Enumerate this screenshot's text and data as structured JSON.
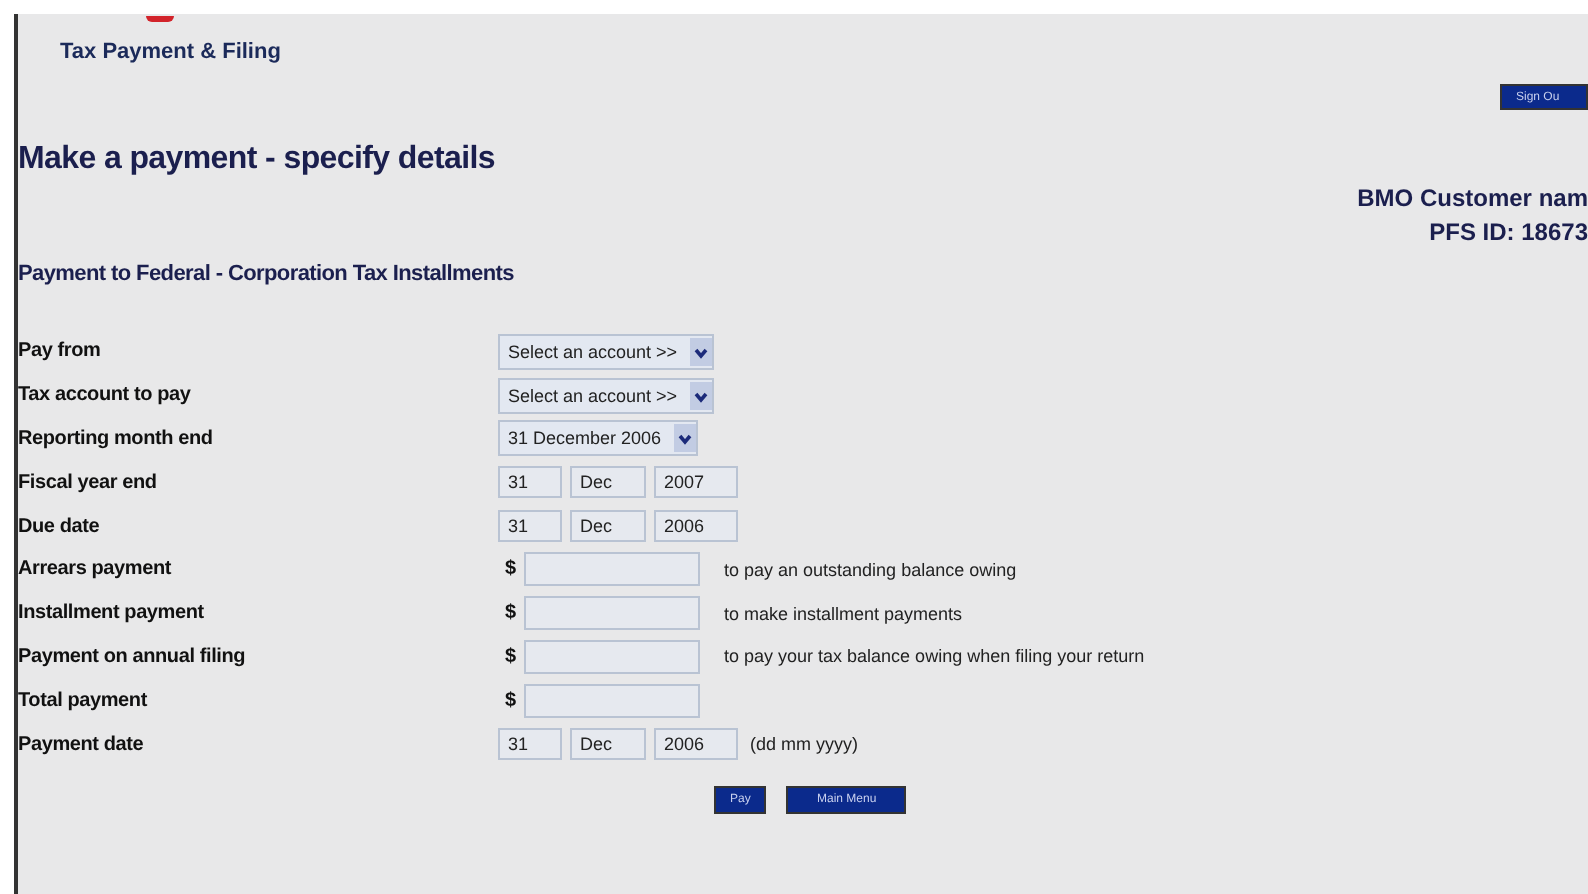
{
  "header": {
    "title": "Tax Payment & Filing",
    "sign_out": "Sign Ou"
  },
  "page_title": "Make a payment - specify details",
  "customer": {
    "name": "BMO Customer nam",
    "pfs_id": "PFS ID:  18673"
  },
  "section_title": "Payment to Federal - Corporation Tax Installments",
  "form_rows": [
    {
      "label": "Pay from",
      "kind": "select",
      "value": "Select an account >>"
    },
    {
      "label": "Tax account to pay",
      "kind": "select",
      "value": "Select an account >>"
    },
    {
      "label": "Reporting month end",
      "kind": "select",
      "value": "31 December 2006"
    },
    {
      "label": "Fiscal year end",
      "kind": "date",
      "day": "31",
      "month": "Dec",
      "year": "2007"
    },
    {
      "label": "Due date",
      "kind": "date",
      "day": "31",
      "month": "Dec",
      "year": "2006"
    },
    {
      "label": "Arrears payment",
      "kind": "amount",
      "currency": "$",
      "note": "to pay an outstanding balance owing"
    },
    {
      "label": "Installment payment",
      "kind": "amount",
      "currency": "$",
      "note": "to make installment payments"
    },
    {
      "label": "Payment on annual filing",
      "kind": "amount",
      "currency": "$",
      "note": "to pay your tax balance owing when filing your return"
    },
    {
      "label": "Total payment",
      "kind": "amount",
      "currency": "$"
    },
    {
      "label": "Payment date",
      "kind": "date",
      "day": "31",
      "month": "Dec",
      "year": "2006",
      "hint": "(dd mm yyyy)"
    }
  ],
  "buttons": [
    "Pay",
    "Main Menu"
  ]
}
